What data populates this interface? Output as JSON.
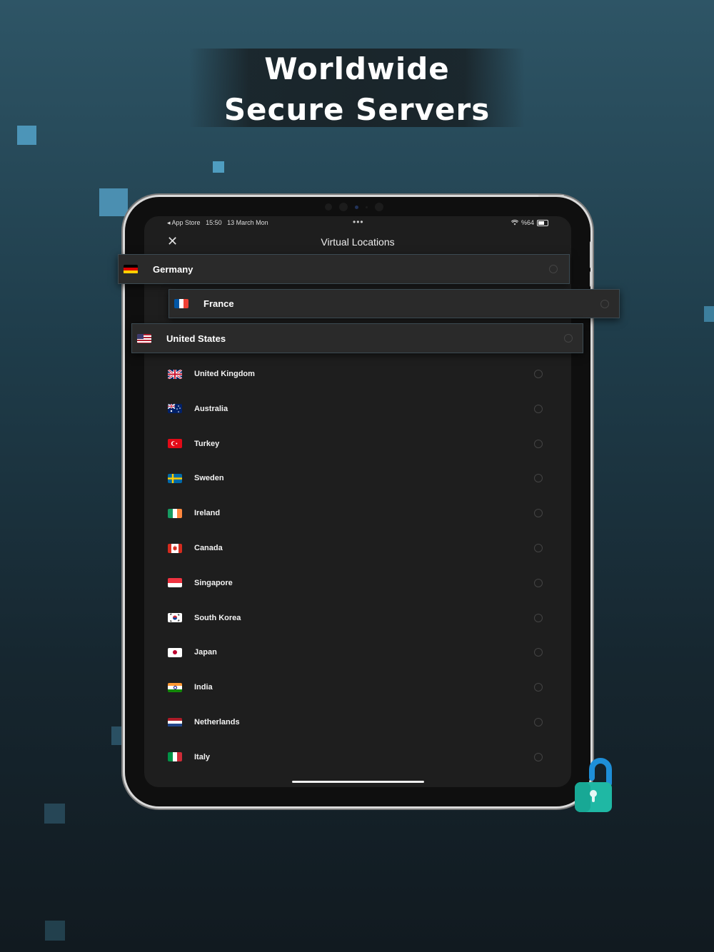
{
  "hero": {
    "line1": "Worldwide",
    "line2": "Secure Servers"
  },
  "status_bar": {
    "back_label": "◂ App Store",
    "time": "15:50",
    "date": "13 March Mon",
    "dots": "•••",
    "battery": "%64"
  },
  "header": {
    "title": "Virtual Locations",
    "close_icon": "close-icon"
  },
  "featured": [
    {
      "name": "Germany",
      "flag": "de"
    },
    {
      "name": "France",
      "flag": "fr"
    },
    {
      "name": "United States",
      "flag": "us"
    }
  ],
  "countries": [
    {
      "name": "United Kingdom",
      "flag": "gb"
    },
    {
      "name": "Australia",
      "flag": "au"
    },
    {
      "name": "Turkey",
      "flag": "tr"
    },
    {
      "name": "Sweden",
      "flag": "se"
    },
    {
      "name": "Ireland",
      "flag": "ie"
    },
    {
      "name": "Canada",
      "flag": "ca"
    },
    {
      "name": "Singapore",
      "flag": "sg"
    },
    {
      "name": "South Korea",
      "flag": "kr"
    },
    {
      "name": "Japan",
      "flag": "jp"
    },
    {
      "name": "India",
      "flag": "in"
    },
    {
      "name": "Netherlands",
      "flag": "nl"
    },
    {
      "name": "Italy",
      "flag": "it"
    }
  ],
  "colors": {
    "accent": "#4a9bc0",
    "lock_body": "#1fb8a4",
    "lock_shackle": "#1e8fd8"
  }
}
